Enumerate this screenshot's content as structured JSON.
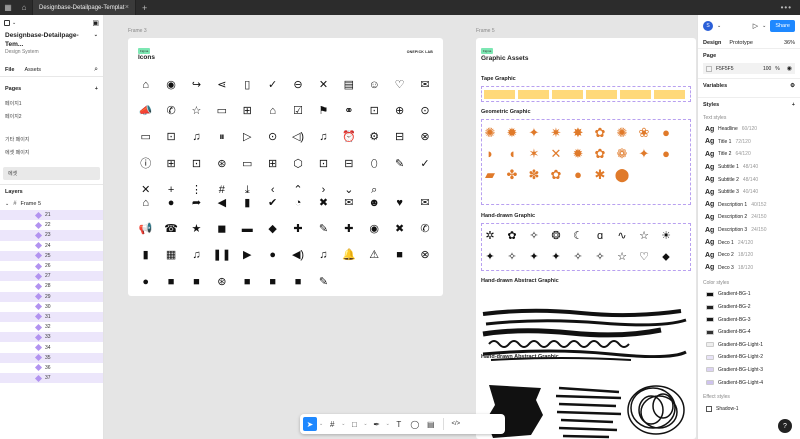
{
  "tabbar": {
    "home_icon": "home-icon",
    "tab_title": "Designbase-Detailpage-Templat",
    "close_glyph": "×",
    "new_tab_glyph": "+",
    "more_glyph": "•••"
  },
  "left_panel": {
    "file_title": "Designbase-Detailpage-Tem...",
    "file_subtitle": "Design System",
    "tabs": [
      "File",
      "Assets"
    ],
    "pages_label": "Pages",
    "pages": [
      "페이지1",
      "페이지2",
      "기타 페이지",
      "에셋 페이지",
      "에셋"
    ],
    "layers_label": "Layers",
    "frame_name": "Frame 5",
    "layer_items": [
      "21",
      "22",
      "23",
      "24",
      "25",
      "26",
      "27",
      "28",
      "29",
      "30",
      "31",
      "32",
      "33",
      "34",
      "35",
      "36",
      "37"
    ]
  },
  "canvas": {
    "frame3_label": "Frame 3",
    "frame5_label": "Frame 5",
    "frame3": {
      "badge": "Figma",
      "top_right": "ONEPICK LAB",
      "title": "Icons",
      "outline_icons": [
        "⌂",
        "◉",
        "↪",
        "⋖",
        "▯",
        "✓",
        "⊖",
        "✕",
        "▤",
        "☺",
        "♡",
        "✉",
        "📣",
        "✆",
        "☆",
        "▭",
        "⊞",
        "⌂",
        "☑",
        "⚑",
        "⚭",
        "⊡",
        "⊕",
        "⊙",
        "▭",
        "⊡",
        "♫",
        "⏸",
        "▷",
        "⊙",
        "◁)",
        "♫",
        "⏰",
        "⚙",
        "⊟",
        "⊗",
        "ⓘ",
        "⊞",
        "⊡",
        "⊛",
        "▭",
        "⊞",
        "⬡",
        "⊡",
        "⊟",
        "⬯",
        "✎",
        "✓",
        "✕",
        "+",
        "⋮",
        "#",
        "⤓",
        "‹",
        "⌃",
        "›",
        "⌄",
        "⌕",
        "",
        ""
      ],
      "solid_icons": [
        "⌂",
        "●",
        "➦",
        "◀",
        "▮",
        "✔",
        "◔",
        "✖",
        "✉",
        "☻",
        "♥",
        "✉",
        "📢",
        "☎",
        "★",
        "◼",
        "▬",
        "◆",
        "✚",
        "✎",
        "✚",
        "◉",
        "✖",
        "✆",
        "▮",
        "▦",
        "♫",
        "❚❚",
        "▶",
        "●",
        "◀)",
        "♫",
        "🔔",
        "⚠",
        "■",
        "⊗",
        "●",
        "■",
        "■",
        "⊛",
        "■",
        "■",
        "■",
        "✎",
        "",
        "",
        "",
        ""
      ]
    },
    "frame5": {
      "badge": "Figma",
      "title": "Graphic Assets",
      "tape_title": "Tape Graphic",
      "geo_title": "Geometric Graphic",
      "hand_title": "Hand-drawn Graphic",
      "abs_title": "Hand-drawn Abstract Graphic",
      "abs_title2": "Hand-drawn Abstract Graphic",
      "geo_shapes": [
        "✺",
        "✹",
        "✦",
        "✷",
        "✸",
        "✿",
        "✺",
        "❀",
        "●",
        "◗",
        "◖",
        "✶",
        "✕",
        "✹",
        "✿",
        "❁",
        "✦",
        "●",
        "▰",
        "✤",
        "✽",
        "✿",
        "●",
        "✱",
        "⬤",
        "",
        ""
      ],
      "hand_shapes": [
        "✲",
        "✿",
        "✧",
        "❂",
        "☾",
        "ɑ",
        "∿",
        "☆",
        "☀",
        "✦",
        "✧",
        "✦",
        "✦",
        "✧",
        "✧",
        "☆",
        "♡",
        "⬥"
      ]
    }
  },
  "toolbar": {
    "tools": [
      "➤",
      "#",
      "□",
      "✒",
      "T",
      "◯",
      "</>"
    ],
    "caret": "⌄"
  },
  "right_panel": {
    "avatar_letter": "S",
    "share_label": "Share",
    "tabs": [
      "Design",
      "Prototype"
    ],
    "zoom": "36%",
    "page_label": "Page",
    "page_color": "F5F5F5",
    "page_opacity": "100",
    "page_pct": "%",
    "variables_label": "Variables",
    "styles_label": "Styles",
    "text_styles_label": "Text styles",
    "text_styles": [
      {
        "name": "Headline",
        "spec": "60/120"
      },
      {
        "name": "Title 1",
        "spec": "72/120"
      },
      {
        "name": "Title 2",
        "spec": "64/120"
      },
      {
        "name": "Subtitle 1",
        "spec": "48/140"
      },
      {
        "name": "Subtitle 2",
        "spec": "48/140"
      },
      {
        "name": "Subtitle 3",
        "spec": "40/140"
      },
      {
        "name": "Description 1",
        "spec": "40/152"
      },
      {
        "name": "Description 2",
        "spec": "24/150"
      },
      {
        "name": "Description 3",
        "spec": "24/150"
      },
      {
        "name": "Deco 1",
        "spec": "24/120"
      },
      {
        "name": "Deco 2",
        "spec": "18/120"
      },
      {
        "name": "Deco 3",
        "spec": "18/120"
      }
    ],
    "color_styles_label": "Color styles",
    "color_styles": [
      {
        "name": "Gradient-BG-1",
        "color": "#111111"
      },
      {
        "name": "Gradient-BG-2",
        "color": "#222222"
      },
      {
        "name": "Gradient-BG-3",
        "color": "#1a1a1a"
      },
      {
        "name": "Gradient-BG-4",
        "color": "#333333"
      },
      {
        "name": "Gradient-BG-Light-1",
        "color": "#eeeeee"
      },
      {
        "name": "Gradient-BG-Light-2",
        "color": "#e8e3f7"
      },
      {
        "name": "Gradient-BG-Light-3",
        "color": "#dcd3f2"
      },
      {
        "name": "Gradient-BG-Light-4",
        "color": "#cfc3ee"
      }
    ],
    "effect_styles_label": "Effect styles",
    "effect_styles": [
      "Shadow-1"
    ],
    "help_glyph": "?"
  }
}
